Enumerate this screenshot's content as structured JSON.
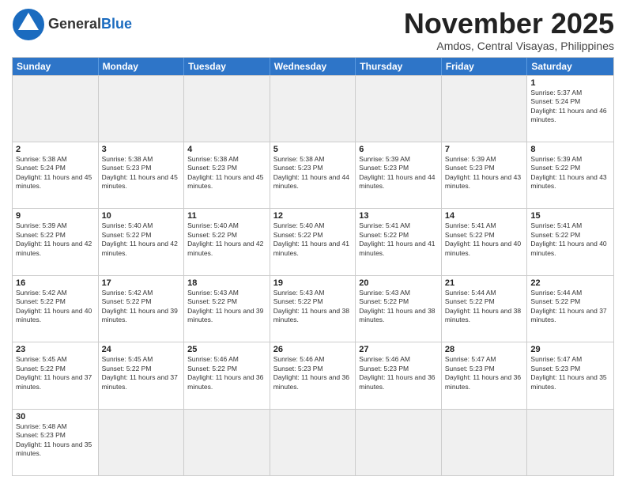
{
  "header": {
    "logo_general": "General",
    "logo_blue": "Blue",
    "month_title": "November 2025",
    "location": "Amdos, Central Visayas, Philippines"
  },
  "days_of_week": [
    "Sunday",
    "Monday",
    "Tuesday",
    "Wednesday",
    "Thursday",
    "Friday",
    "Saturday"
  ],
  "weeks": [
    [
      {
        "day": "",
        "info": ""
      },
      {
        "day": "",
        "info": ""
      },
      {
        "day": "",
        "info": ""
      },
      {
        "day": "",
        "info": ""
      },
      {
        "day": "",
        "info": ""
      },
      {
        "day": "",
        "info": ""
      },
      {
        "day": "1",
        "info": "Sunrise: 5:37 AM\nSunset: 5:24 PM\nDaylight: 11 hours and 46 minutes."
      }
    ],
    [
      {
        "day": "2",
        "info": "Sunrise: 5:38 AM\nSunset: 5:24 PM\nDaylight: 11 hours and 45 minutes."
      },
      {
        "day": "3",
        "info": "Sunrise: 5:38 AM\nSunset: 5:23 PM\nDaylight: 11 hours and 45 minutes."
      },
      {
        "day": "4",
        "info": "Sunrise: 5:38 AM\nSunset: 5:23 PM\nDaylight: 11 hours and 45 minutes."
      },
      {
        "day": "5",
        "info": "Sunrise: 5:38 AM\nSunset: 5:23 PM\nDaylight: 11 hours and 44 minutes."
      },
      {
        "day": "6",
        "info": "Sunrise: 5:39 AM\nSunset: 5:23 PM\nDaylight: 11 hours and 44 minutes."
      },
      {
        "day": "7",
        "info": "Sunrise: 5:39 AM\nSunset: 5:23 PM\nDaylight: 11 hours and 43 minutes."
      },
      {
        "day": "8",
        "info": "Sunrise: 5:39 AM\nSunset: 5:22 PM\nDaylight: 11 hours and 43 minutes."
      }
    ],
    [
      {
        "day": "9",
        "info": "Sunrise: 5:39 AM\nSunset: 5:22 PM\nDaylight: 11 hours and 42 minutes."
      },
      {
        "day": "10",
        "info": "Sunrise: 5:40 AM\nSunset: 5:22 PM\nDaylight: 11 hours and 42 minutes."
      },
      {
        "day": "11",
        "info": "Sunrise: 5:40 AM\nSunset: 5:22 PM\nDaylight: 11 hours and 42 minutes."
      },
      {
        "day": "12",
        "info": "Sunrise: 5:40 AM\nSunset: 5:22 PM\nDaylight: 11 hours and 41 minutes."
      },
      {
        "day": "13",
        "info": "Sunrise: 5:41 AM\nSunset: 5:22 PM\nDaylight: 11 hours and 41 minutes."
      },
      {
        "day": "14",
        "info": "Sunrise: 5:41 AM\nSunset: 5:22 PM\nDaylight: 11 hours and 40 minutes."
      },
      {
        "day": "15",
        "info": "Sunrise: 5:41 AM\nSunset: 5:22 PM\nDaylight: 11 hours and 40 minutes."
      }
    ],
    [
      {
        "day": "16",
        "info": "Sunrise: 5:42 AM\nSunset: 5:22 PM\nDaylight: 11 hours and 40 minutes."
      },
      {
        "day": "17",
        "info": "Sunrise: 5:42 AM\nSunset: 5:22 PM\nDaylight: 11 hours and 39 minutes."
      },
      {
        "day": "18",
        "info": "Sunrise: 5:43 AM\nSunset: 5:22 PM\nDaylight: 11 hours and 39 minutes."
      },
      {
        "day": "19",
        "info": "Sunrise: 5:43 AM\nSunset: 5:22 PM\nDaylight: 11 hours and 38 minutes."
      },
      {
        "day": "20",
        "info": "Sunrise: 5:43 AM\nSunset: 5:22 PM\nDaylight: 11 hours and 38 minutes."
      },
      {
        "day": "21",
        "info": "Sunrise: 5:44 AM\nSunset: 5:22 PM\nDaylight: 11 hours and 38 minutes."
      },
      {
        "day": "22",
        "info": "Sunrise: 5:44 AM\nSunset: 5:22 PM\nDaylight: 11 hours and 37 minutes."
      }
    ],
    [
      {
        "day": "23",
        "info": "Sunrise: 5:45 AM\nSunset: 5:22 PM\nDaylight: 11 hours and 37 minutes."
      },
      {
        "day": "24",
        "info": "Sunrise: 5:45 AM\nSunset: 5:22 PM\nDaylight: 11 hours and 37 minutes."
      },
      {
        "day": "25",
        "info": "Sunrise: 5:46 AM\nSunset: 5:22 PM\nDaylight: 11 hours and 36 minutes."
      },
      {
        "day": "26",
        "info": "Sunrise: 5:46 AM\nSunset: 5:23 PM\nDaylight: 11 hours and 36 minutes."
      },
      {
        "day": "27",
        "info": "Sunrise: 5:46 AM\nSunset: 5:23 PM\nDaylight: 11 hours and 36 minutes."
      },
      {
        "day": "28",
        "info": "Sunrise: 5:47 AM\nSunset: 5:23 PM\nDaylight: 11 hours and 36 minutes."
      },
      {
        "day": "29",
        "info": "Sunrise: 5:47 AM\nSunset: 5:23 PM\nDaylight: 11 hours and 35 minutes."
      }
    ],
    [
      {
        "day": "30",
        "info": "Sunrise: 5:48 AM\nSunset: 5:23 PM\nDaylight: 11 hours and 35 minutes."
      },
      {
        "day": "",
        "info": ""
      },
      {
        "day": "",
        "info": ""
      },
      {
        "day": "",
        "info": ""
      },
      {
        "day": "",
        "info": ""
      },
      {
        "day": "",
        "info": ""
      },
      {
        "day": "",
        "info": ""
      }
    ]
  ]
}
